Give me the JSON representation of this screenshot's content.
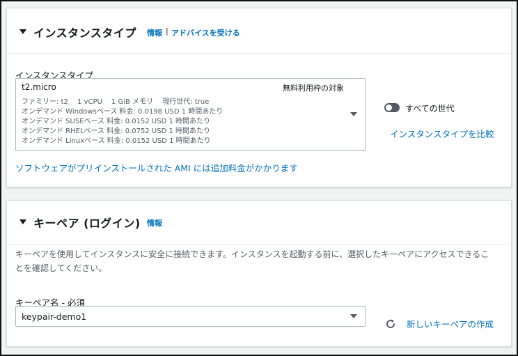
{
  "instance_type_section": {
    "title": "インスタンスタイプ",
    "info_link": "情報",
    "separator": "|",
    "advice_link": "アドバイスを受ける",
    "field_label": "インスタンスタイプ",
    "selected": {
      "name": "t2.micro",
      "badge": "無料利用枠の対象",
      "details": [
        "ファミリー: t2　 1 vCPU　 1 GiB メモリ　 現行世代: true",
        "オンデマンド Windowsベース 料金: 0.0198 USD 1 時間あたり",
        "オンデマンド SUSEベース 料金: 0.0152 USD 1 時間あたり",
        "オンデマンド RHELベース 料金: 0.0752 USD 1 時間あたり",
        "オンデマンド Linuxベース 料金: 0.0152 USD 1 時間あたり"
      ]
    },
    "toggle_label": "すべての世代",
    "compare_link": "インスタンスタイプを比較",
    "ami_note": "ソフトウェアがプリインストールされた AMI には追加料金がかかります"
  },
  "keypair_section": {
    "title": "キーペア (ログイン)",
    "info_link": "情報",
    "description": "キーペアを使用してインスタンスに安全に接続できます。インスタンスを起動する前に、選択したキーペアにアクセスできることを確認してください。",
    "field_label": "キーペア名 - 必須",
    "selected": "keypair-demo1",
    "create_link": "新しいキーペアの作成"
  },
  "colors": {
    "link": "#0073bb",
    "toggle_off": "#545b64"
  },
  "icons": [
    "collapse-caret-icon",
    "dropdown-arrow-icon",
    "refresh-icon"
  ]
}
